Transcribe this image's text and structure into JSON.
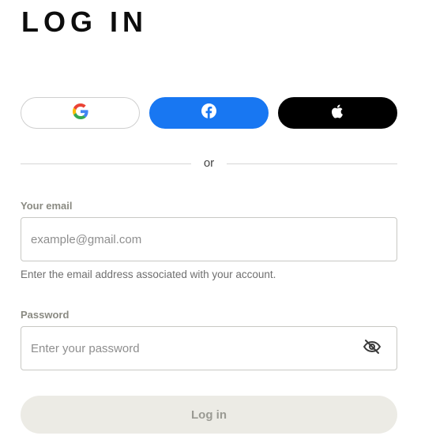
{
  "page": {
    "title": "LOG IN"
  },
  "social": {
    "google": {
      "icon": "google-icon",
      "brand_color": "#ffffff"
    },
    "facebook": {
      "icon": "facebook-icon",
      "brand_color": "#1877f2"
    },
    "apple": {
      "icon": "apple-icon",
      "brand_color": "#000000"
    }
  },
  "divider": {
    "text": "or"
  },
  "email": {
    "label": "Your email",
    "placeholder": "example@gmail.com",
    "value": "",
    "helper": "Enter the email address associated with your account."
  },
  "password": {
    "label": "Password",
    "placeholder": "Enter your password",
    "value": "",
    "visibility_icon": "eye-off-icon"
  },
  "submit": {
    "label": "Log in",
    "state": "disabled"
  }
}
